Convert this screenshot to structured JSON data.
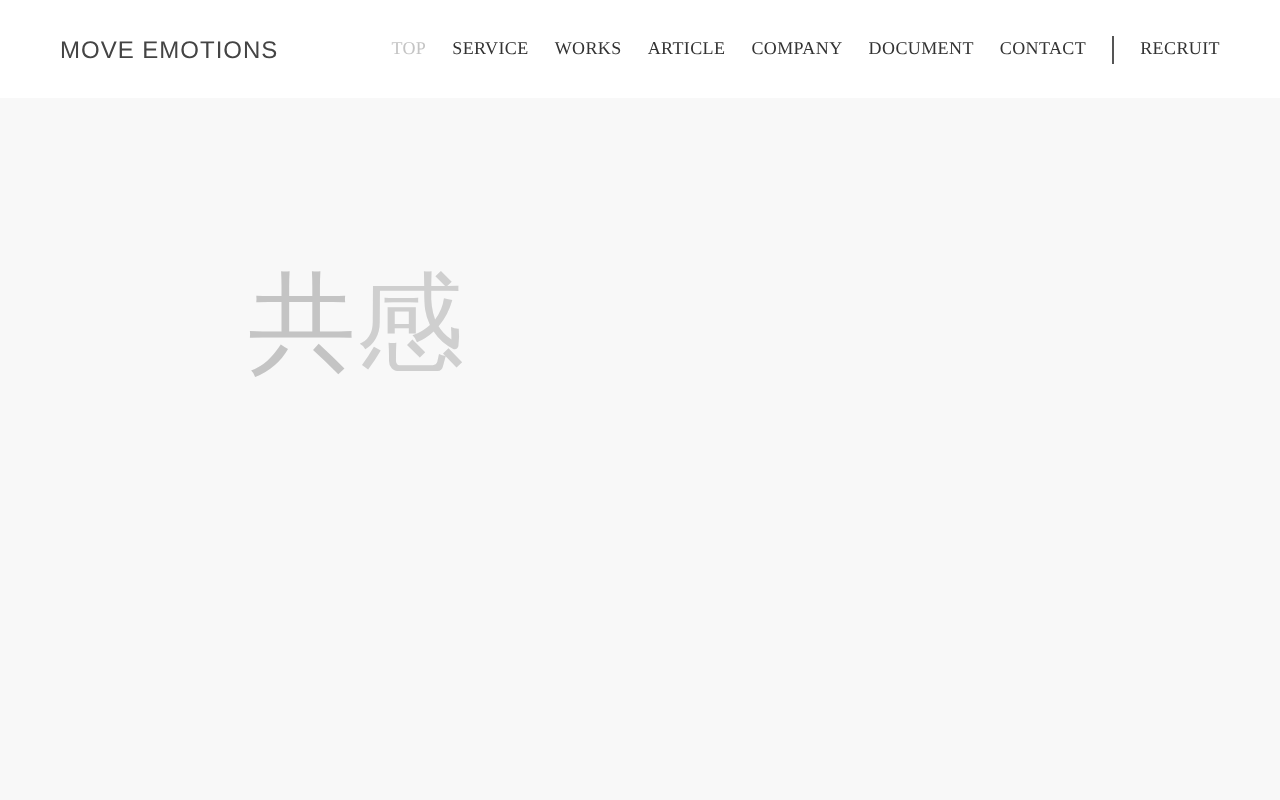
{
  "header": {
    "logo": "MOVE EMOTIONS",
    "nav": [
      {
        "label": "TOP",
        "selected": true
      },
      {
        "label": "SERVICE",
        "selected": false
      },
      {
        "label": "WORKS",
        "selected": false
      },
      {
        "label": "ARTICLE",
        "selected": false
      },
      {
        "label": "COMPANY",
        "selected": false
      },
      {
        "label": "DOCUMENT",
        "selected": false
      },
      {
        "label": "CONTACT",
        "selected": false
      }
    ],
    "recruit": "RECRUIT"
  },
  "hero": {
    "characters": [
      {
        "text": "共",
        "color": "#c4c4c4"
      },
      {
        "text": "感",
        "color": "#cfcfcf"
      }
    ]
  }
}
